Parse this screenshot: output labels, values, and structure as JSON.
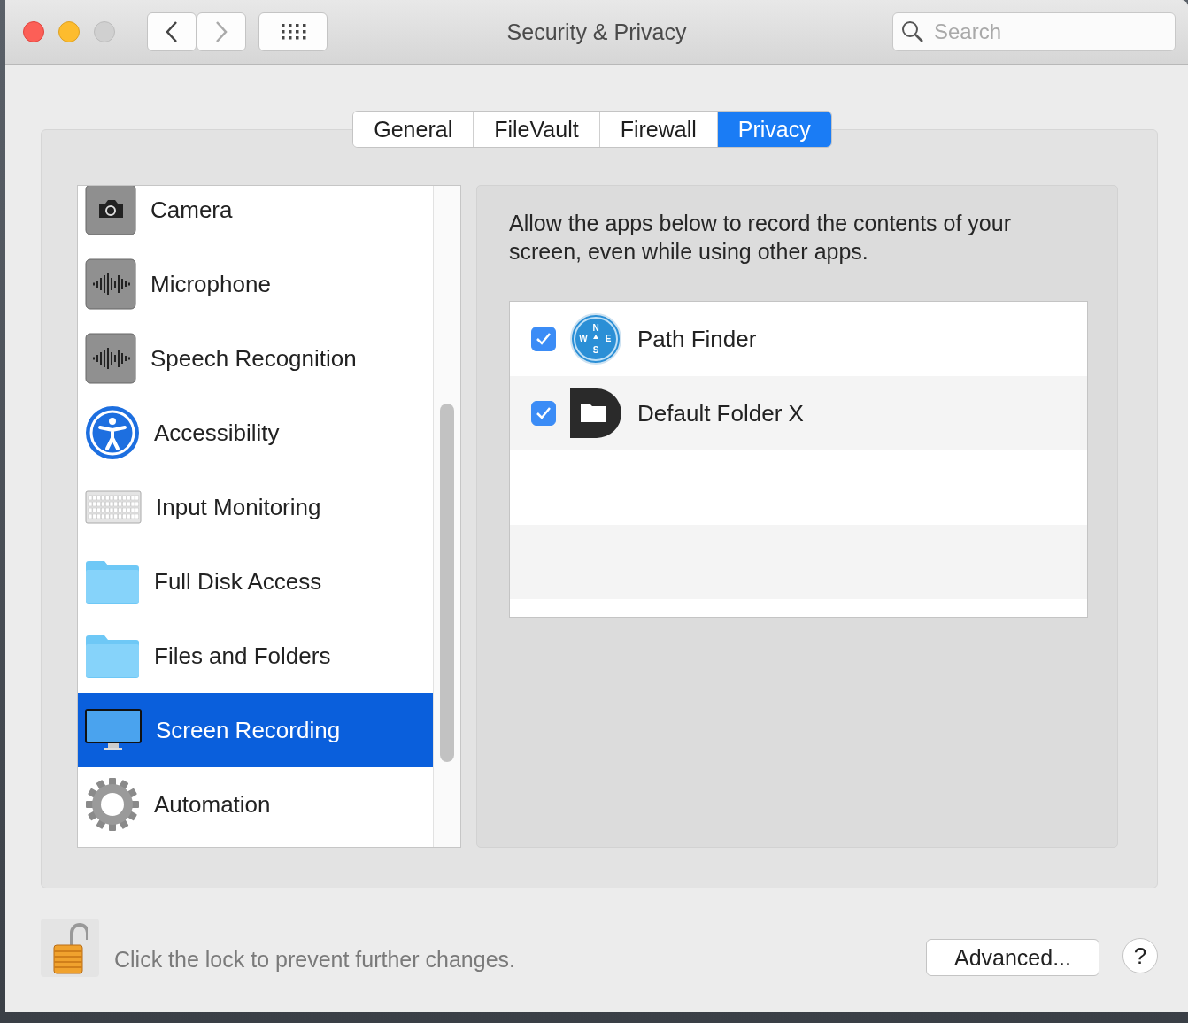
{
  "window": {
    "title": "Security & Privacy"
  },
  "search": {
    "placeholder": "Search"
  },
  "tabs": [
    {
      "label": "General",
      "selected": false
    },
    {
      "label": "FileVault",
      "selected": false
    },
    {
      "label": "Firewall",
      "selected": false
    },
    {
      "label": "Privacy",
      "selected": true
    }
  ],
  "sidebar": {
    "items": [
      {
        "label": "Camera",
        "kind": "camera",
        "selected": false
      },
      {
        "label": "Microphone",
        "kind": "wave",
        "selected": false
      },
      {
        "label": "Speech Recognition",
        "kind": "wave",
        "selected": false
      },
      {
        "label": "Accessibility",
        "kind": "accessibility",
        "selected": false
      },
      {
        "label": "Input Monitoring",
        "kind": "keyboard",
        "selected": false
      },
      {
        "label": "Full Disk Access",
        "kind": "folder",
        "selected": false
      },
      {
        "label": "Files and Folders",
        "kind": "folder",
        "selected": false
      },
      {
        "label": "Screen Recording",
        "kind": "display",
        "selected": true
      },
      {
        "label": "Automation",
        "kind": "gear",
        "selected": false
      }
    ]
  },
  "description": "Allow the apps below to record the contents of your screen, even while using other apps.",
  "apps": [
    {
      "name": "Path Finder",
      "checked": true,
      "kind": "compass",
      "icon_letters": [
        "N",
        "E",
        "S",
        "W"
      ]
    },
    {
      "name": "Default Folder X",
      "checked": true,
      "kind": "dfolder"
    }
  ],
  "footer": {
    "lock_text": "Click the lock to prevent further changes.",
    "locked": false,
    "advanced_button": "Advanced...",
    "help_button": "?"
  }
}
